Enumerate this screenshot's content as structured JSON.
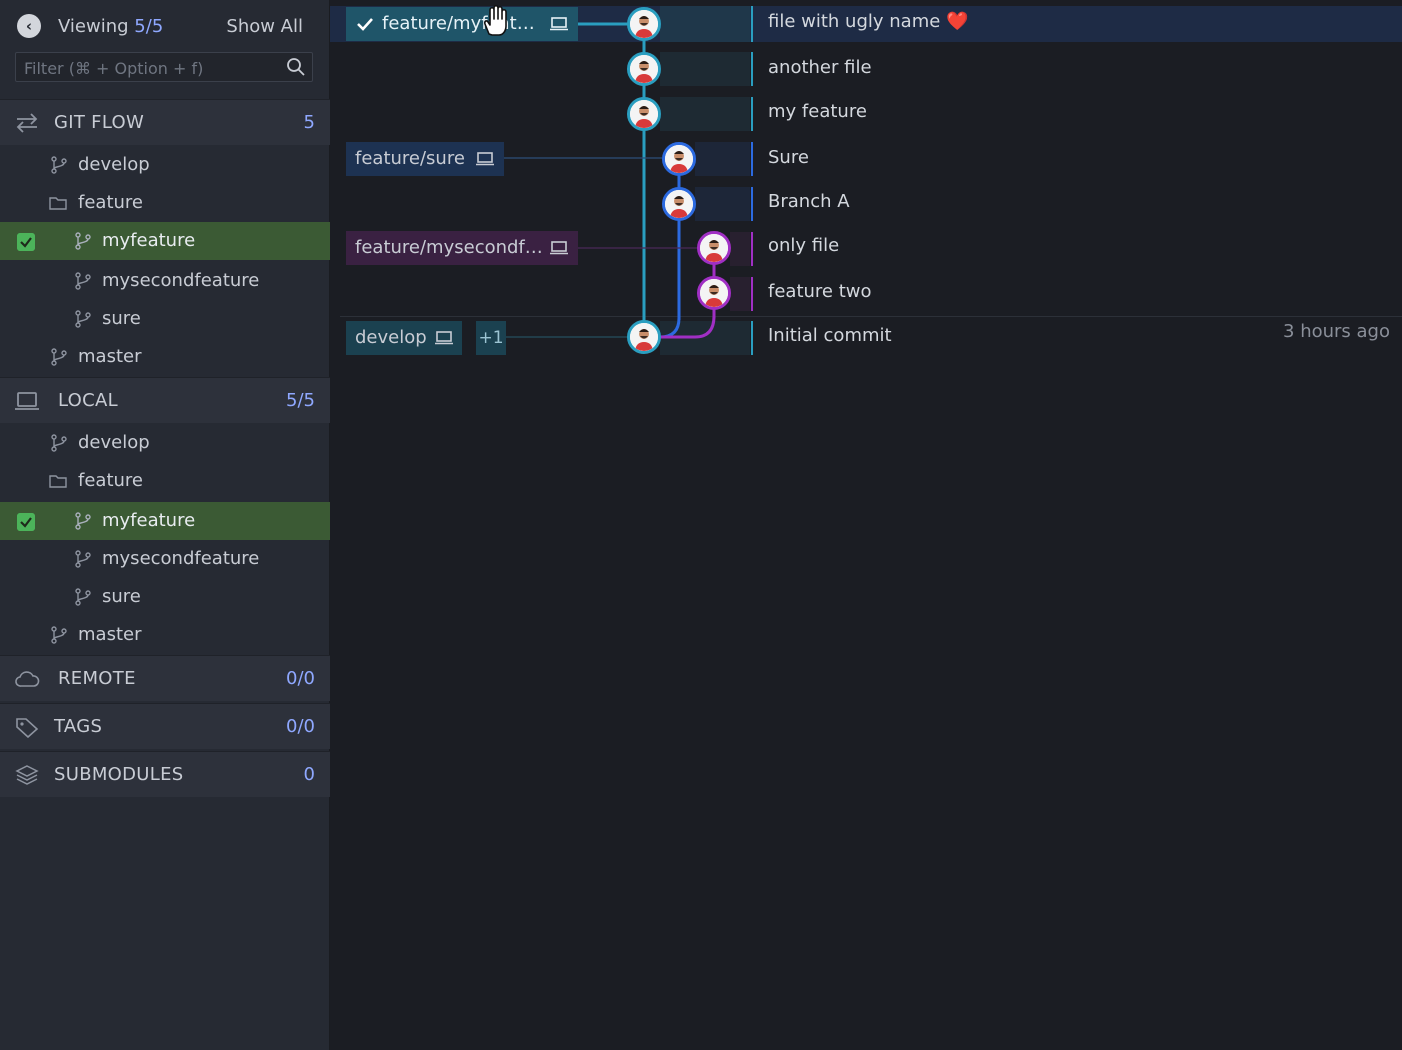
{
  "sidebar": {
    "viewing_label": "Viewing",
    "viewing_count": "5",
    "viewing_total": "5",
    "show_all": "Show All",
    "filter_placeholder": "Filter (⌘ + Option + f)",
    "gitflow": {
      "label": "GIT FLOW",
      "count": "5",
      "items": [
        {
          "label": "develop",
          "icon": "branch-icon"
        },
        {
          "label": "feature",
          "icon": "folder-icon"
        },
        {
          "label": "myfeature",
          "icon": "branch-icon",
          "checked": true
        },
        {
          "label": "mysecondfeature",
          "icon": "branch-icon"
        },
        {
          "label": "sure",
          "icon": "branch-icon"
        },
        {
          "label": "master",
          "icon": "branch-icon"
        }
      ]
    },
    "local": {
      "label": "LOCAL",
      "count_a": "5",
      "count_b": "5",
      "items": [
        {
          "label": "develop",
          "icon": "branch-icon"
        },
        {
          "label": "feature",
          "icon": "folder-icon"
        },
        {
          "label": "myfeature",
          "icon": "branch-icon",
          "checked": true
        },
        {
          "label": "mysecondfeature",
          "icon": "branch-icon"
        },
        {
          "label": "sure",
          "icon": "branch-icon"
        },
        {
          "label": "master",
          "icon": "branch-icon"
        }
      ]
    },
    "remote": {
      "label": "REMOTE",
      "count_a": "0",
      "count_b": "0"
    },
    "tags": {
      "label": "TAGS",
      "count_a": "0",
      "count_b": "0"
    },
    "submodules": {
      "label": "SUBMODULES",
      "count": "0"
    }
  },
  "graph": {
    "branch_tags": {
      "current": "feature/myfeat…",
      "sure": "feature/sure",
      "mysecond": "feature/mysecondf…",
      "develop": "develop",
      "more": "+1"
    },
    "commits": [
      {
        "message": "file with ugly name ❤️",
        "time": ""
      },
      {
        "message": "another file",
        "time": ""
      },
      {
        "message": "my feature",
        "time": ""
      },
      {
        "message": "Sure",
        "time": ""
      },
      {
        "message": "Branch A",
        "time": ""
      },
      {
        "message": "only file",
        "time": ""
      },
      {
        "message": "feature two",
        "time": ""
      },
      {
        "message": "Initial commit",
        "time": "3 hours ago"
      }
    ]
  },
  "colors": {
    "teal": "#2a9ec0",
    "blue": "#2c6ae0",
    "purple": "#a02fc4",
    "selected_green": "#3b5a34",
    "accent_count": "#8fa8ff"
  }
}
